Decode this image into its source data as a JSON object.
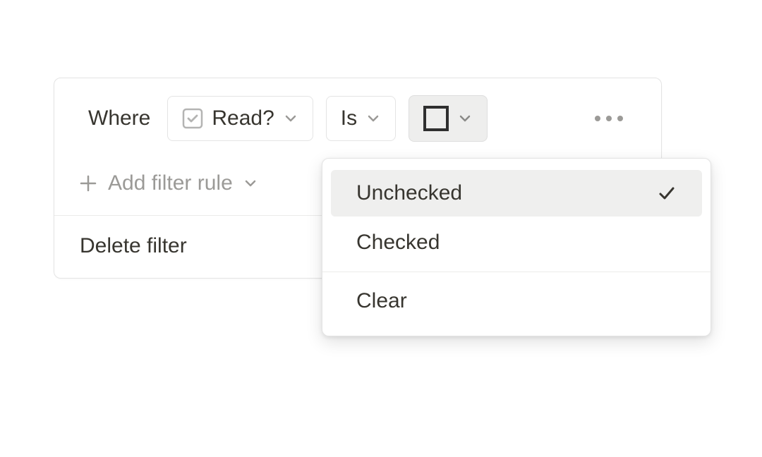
{
  "filter": {
    "where_label": "Where",
    "property": {
      "label": "Read?"
    },
    "operator": {
      "label": "Is"
    },
    "add_rule_label": "Add filter rule",
    "delete_label": "Delete filter"
  },
  "dropdown": {
    "options": [
      {
        "label": "Unchecked",
        "selected": true
      },
      {
        "label": "Checked",
        "selected": false
      }
    ],
    "clear_label": "Clear"
  }
}
